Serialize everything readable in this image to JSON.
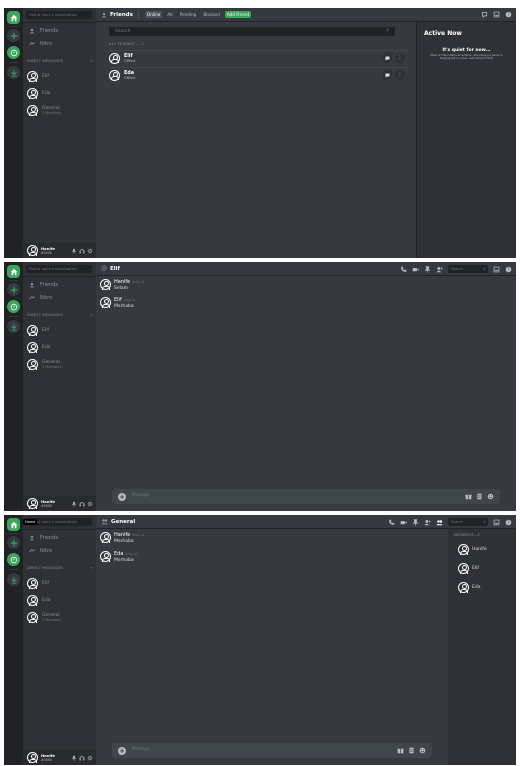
{
  "dm_search_placeholder": "Find or start a conversation",
  "sidebar": {
    "friends_label": "Friends",
    "nitro_label": "Nitro",
    "dm_header": "DIRECT MESSAGES",
    "dms": [
      {
        "name": "Elif"
      },
      {
        "name": "Eda"
      },
      {
        "name": "General",
        "sub": "3 Members"
      }
    ]
  },
  "user": {
    "name": "Hanife",
    "status": "#0000"
  },
  "friends_view": {
    "title": "Friends",
    "tabs": [
      "Online",
      "All",
      "Pending",
      "Blocked"
    ],
    "add_friend": "Add Friend",
    "search_placeholder": "Search",
    "online_header": "ALL FRIENDS — 2",
    "friends": [
      {
        "name": "Elif",
        "status": "Offline"
      },
      {
        "name": "Eda",
        "status": "Offline"
      }
    ],
    "active_now": {
      "title": "Active Now",
      "quiet": "It's quiet for now...",
      "desc": "When a friend starts an activity—like playing a game or hanging out on voice—we'll show it here!"
    }
  },
  "dm_view": {
    "title": "Elif",
    "search_placeholder": "Search",
    "messages": [
      {
        "author": "Hanife",
        "time": "Today at",
        "text": "Selam"
      },
      {
        "author": "Elif",
        "time": "Today at",
        "text": "Merhaba"
      }
    ],
    "composer_placeholder": "Message"
  },
  "group_view": {
    "title": "General",
    "home_tooltip": "Home",
    "search_placeholder": "Search",
    "messages": [
      {
        "author": "Hanife",
        "time": "Today at",
        "text": "Merhaba"
      },
      {
        "author": "Eda",
        "time": "Today at",
        "text": "Merhaba"
      }
    ],
    "composer_placeholder": "Message",
    "members_header": "MEMBERS—3",
    "members": [
      "Hanife",
      "Elif",
      "Eda"
    ]
  },
  "colors": {
    "accent_green": "#3ba55c",
    "background": "#36393f",
    "sidebar": "#2f3136",
    "rail": "#202225"
  }
}
